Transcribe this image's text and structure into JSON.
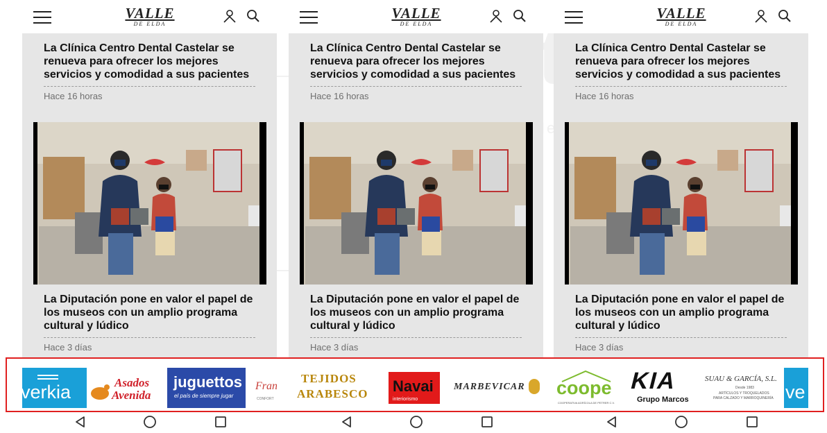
{
  "header": {
    "logo_main": "VALLE",
    "logo_sub": "DE ELDA",
    "menu_icon": "hamburger-menu-icon",
    "user_icon": "user-icon",
    "search_icon": "search-icon"
  },
  "articles": [
    {
      "title": "La Clínica Centro Dental Castelar se renueva para ofrecer los mejores servicios y comodidad a sus pacientes",
      "time": "Hace 16 horas"
    },
    {
      "title": "La Diputación pone en valor el papel de los museos con un amplio programa cultural y lúdico",
      "time": "Hace 3 días"
    }
  ],
  "ads": {
    "screen1": {
      "verkia": "verkia",
      "asados_line1": "Asados",
      "asados_line2": "Avenida",
      "juguettos": "juguettos",
      "juguettos_tag": "el país de siempre jugar",
      "partial": "Fran",
      "partial_sub": "CONFORT"
    },
    "screen2": {
      "tejidos_line1": "TEJIDOS",
      "tejidos_line2": "ARABESCO",
      "navai": "Navai",
      "navai_sub": "interiorismo",
      "marbevicar": "MARBEVICAR"
    },
    "screen3": {
      "coope": "coope",
      "coope_sub": "COOPERATIVA AGRÍCOLA DE PETRER C.V.",
      "kia": "KIA",
      "kia_sub": "Grupo Marcos",
      "suau": "SUAU & GARCÍA, S.L.",
      "suau_since": "Desde 1983",
      "suau_line1": "ARTÍCULOS Y TROQUELADOS",
      "suau_line2": "PARA CALZADO Y MARROQUINERÍA",
      "partial": "ve"
    }
  },
  "navbar": {
    "back_icon": "back-triangle-icon",
    "home_icon": "home-circle-icon",
    "recents_icon": "recents-square-icon"
  },
  "colors": {
    "highlight": "#e02020",
    "feed_bg": "#e6e6e6",
    "verkia_blue": "#1aa0d8",
    "juguettos_blue": "#2b4aa8",
    "asados_red": "#d0202a"
  }
}
